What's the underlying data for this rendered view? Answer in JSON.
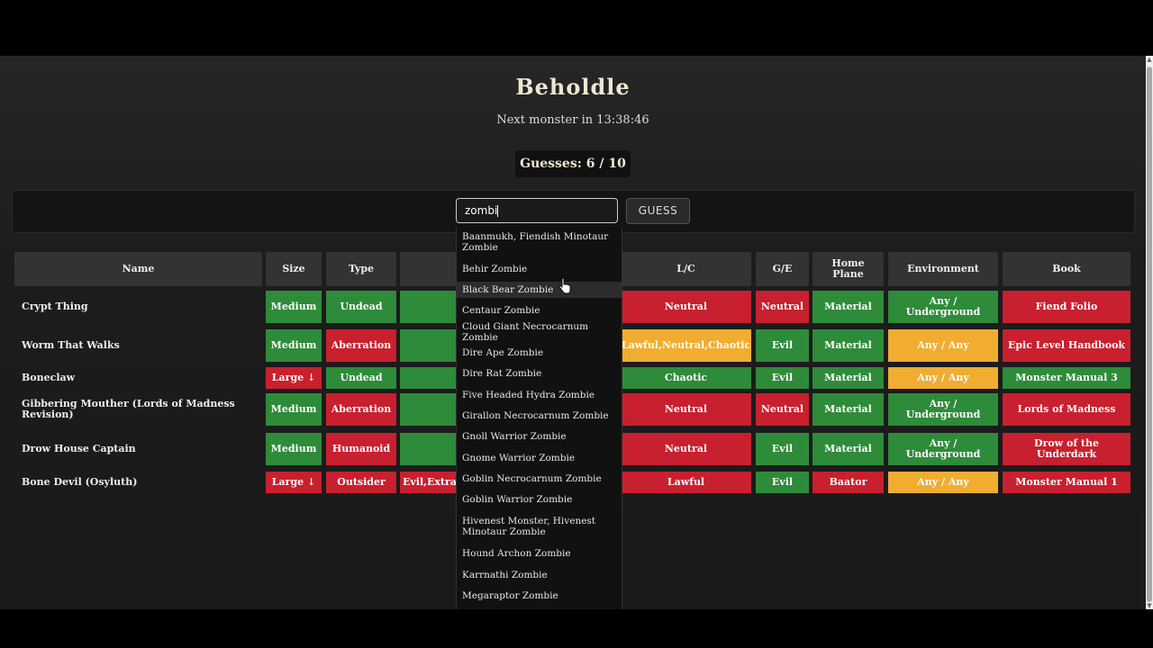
{
  "app": {
    "title": "Beholdle",
    "countdown": "Next monster in 13:38:46",
    "guesses": "Guesses: 6 / 10"
  },
  "search": {
    "value": "zombi"
  },
  "guess_button": "GUESS",
  "columns": [
    "Name",
    "Size",
    "Type",
    "",
    "L/C",
    "G/E",
    "Home Plane",
    "Environment",
    "Book"
  ],
  "rows": [
    {
      "name": "Crypt Thing",
      "size": "Medium",
      "type": "Undead",
      "sub": "",
      "lc": "Neutral",
      "ge": "Neutral",
      "plane": "Material",
      "env": "Any / Underground",
      "book": "Fiend Folio"
    },
    {
      "name": "Worm That Walks",
      "size": "Medium",
      "type": "Aberration",
      "sub": "",
      "lc": "Lawful,Neutral,Chaotic",
      "ge": "Evil",
      "plane": "Material",
      "env": "Any / Any",
      "book": "Epic Level Handbook"
    },
    {
      "name": "Boneclaw",
      "size": "Large ↓",
      "type": "Undead",
      "sub": "",
      "lc": "Chaotic",
      "ge": "Evil",
      "plane": "Material",
      "env": "Any / Any",
      "book": "Monster Manual 3"
    },
    {
      "name": "Gibbering Mouther (Lords of Madness Revision)",
      "size": "Medium",
      "type": "Aberration",
      "sub": "",
      "lc": "Neutral",
      "ge": "Neutral",
      "plane": "Material",
      "env": "Any / Underground",
      "book": "Lords of Madness"
    },
    {
      "name": "Drow House Captain",
      "size": "Medium",
      "type": "Humanoid",
      "sub": "",
      "lc": "Neutral",
      "ge": "Evil",
      "plane": "Material",
      "env": "Any / Underground",
      "book": "Drow of the Underdark"
    },
    {
      "name": "Bone Devil (Osyluth)",
      "size": "Large ↓",
      "type": "Outsider",
      "sub": "Evil,Extra",
      "lc": "Lawful",
      "ge": "Evil",
      "plane": "Baator",
      "env": "Any / Any",
      "book": "Monster Manual 1"
    }
  ],
  "row_colors": [
    {
      "size": "green",
      "type": "green",
      "sub": "green",
      "lc": "red",
      "ge": "red",
      "plane": "green",
      "env": "green",
      "book": "red"
    },
    {
      "size": "green",
      "type": "red",
      "sub": "green",
      "lc": "yellow",
      "ge": "green",
      "plane": "green",
      "env": "yellow",
      "book": "red"
    },
    {
      "size": "red",
      "type": "green",
      "sub": "green",
      "lc": "green",
      "ge": "green",
      "plane": "green",
      "env": "yellow",
      "book": "green"
    },
    {
      "size": "green",
      "type": "red",
      "sub": "green",
      "lc": "red",
      "ge": "red",
      "plane": "green",
      "env": "green",
      "book": "red"
    },
    {
      "size": "green",
      "type": "red",
      "sub": "green",
      "lc": "red",
      "ge": "green",
      "plane": "green",
      "env": "green",
      "book": "red"
    },
    {
      "size": "red",
      "type": "red",
      "sub": "red",
      "lc": "red",
      "ge": "green",
      "plane": "red",
      "env": "yellow",
      "book": "red"
    }
  ],
  "dropdown": [
    "Baanmukh, Fiendish Minotaur Zombie",
    "Behir Zombie",
    "Black Bear Zombie",
    "Centaur Zombie",
    "Cloud Giant Necrocarnum Zombie",
    "Dire Ape Zombie",
    "Dire Rat Zombie",
    "Five Headed Hydra Zombie",
    "Girallon Necrocarnum Zombie",
    "Gnoll Warrior Zombie",
    "Gnome Warrior Zombie",
    "Goblin Necrocarnum Zombie",
    "Goblin Warrior Zombie",
    "Hivenest Monster, Hivenest Minotaur Zombie",
    "Hound Archon Zombie",
    "Karrnathi Zombie",
    "Megaraptor Zombie"
  ],
  "dropdown_hover_index": 2,
  "colors": {
    "green": "#2e8b3a",
    "red": "#c8202e",
    "yellow": "#f0ad30",
    "header": "#333333"
  }
}
